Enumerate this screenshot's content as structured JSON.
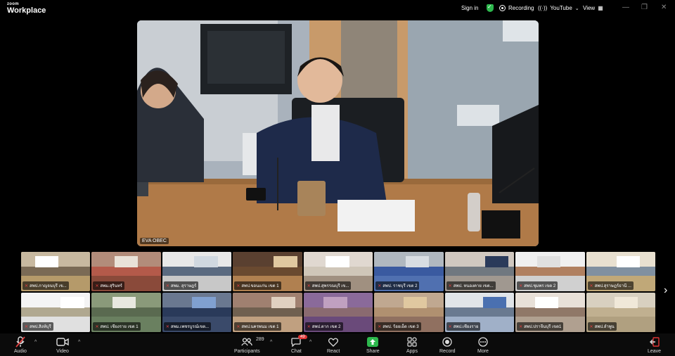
{
  "brand": {
    "line1": "zoom",
    "line2": "Workplace"
  },
  "topbar": {
    "signin": "Sign in",
    "recording": "Recording",
    "youtube": "YouTube",
    "view": "View"
  },
  "main_video": {
    "name": "EVA OBEC"
  },
  "gallery": {
    "tiles": [
      "สพป.กาญจนบุรี เข...",
      "สพม.สุรินทร์",
      "สพม. สุราษฎร์",
      "สพป.ขอนแก่น เขต 1",
      "สพป.สุพรรณบุรี เข...",
      "สพป. ราชบุรี เขต 2",
      "สพป. หนองคาย เขต...",
      "สพป.ชุมพร เขต 2",
      "สพป.สุราษฎร์ธานี ...",
      "สพป.สิงห์บุรี",
      "สพป. เชียงราย เขต 1",
      "สพม.เพชรบูรณ์เขต...",
      "สพป.นครพนม เขต 1",
      "สพป.ตาก เขต 2",
      "สพป. ร้อยเอ็ด เขต 3",
      "สพป.เชียงราย",
      "สพป.ปราจีนบุรี เขต1",
      "สพป.ลำพูน"
    ]
  },
  "toolbar": {
    "audio": "Audio",
    "video": "Video",
    "participants": "Participants",
    "participants_count": "289",
    "chat": "Chat",
    "chat_badge": "49",
    "react": "React",
    "share": "Share",
    "apps": "Apps",
    "record": "Record",
    "more": "More",
    "leave": "Leave"
  },
  "colors": {
    "share": "#2db84d",
    "leave": "#e03434",
    "mic_off": "#e04040"
  }
}
